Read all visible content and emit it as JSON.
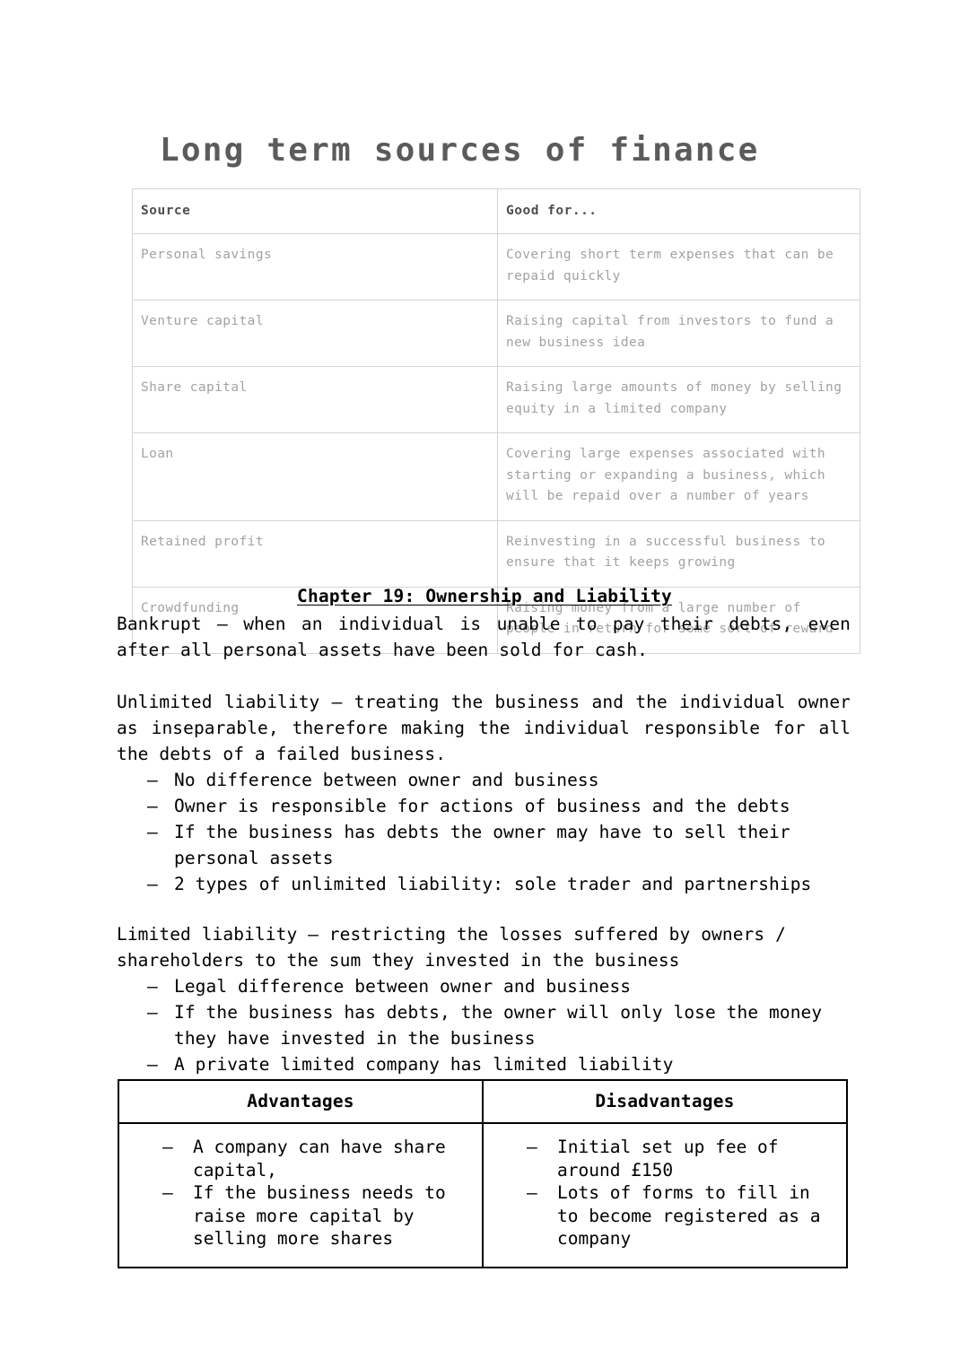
{
  "document": {
    "title": "Long term sources of finance"
  },
  "sources_table": {
    "headers": [
      "Source",
      "Good for..."
    ],
    "rows": [
      {
        "source": "Personal savings",
        "good_for": "Covering short term expenses that can be repaid quickly"
      },
      {
        "source": "Venture capital",
        "good_for": "Raising capital from investors to fund a new business idea"
      },
      {
        "source": "Share capital",
        "good_for": "Raising large amounts of money by selling equity in a limited company"
      },
      {
        "source": "Loan",
        "good_for": "Covering large expenses associated with starting or expanding a business, which will be repaid over a number of years"
      },
      {
        "source": "Retained profit",
        "good_for": "Reinvesting in a successful business to ensure that it keeps growing"
      },
      {
        "source": "Crowdfunding",
        "good_for": "Raising money from a large number of people in return for some sort of reward"
      }
    ]
  },
  "chapter": {
    "heading": "Chapter 19: Ownership and Liability"
  },
  "bankrupt": {
    "definition": "Bankrupt – when an individual is unable to pay their debts, even after all personal assets have been sold for cash."
  },
  "unlimited_liability": {
    "definition": "Unlimited liability – treating the business and the individual owner as inseparable, therefore making the individual responsible for all the debts of a failed business.",
    "bullets": [
      "No difference between owner and business",
      "Owner is responsible for actions of business and the debts",
      "If the business has debts the owner may have to sell their personal assets",
      "2 types of unlimited liability: sole trader and partnerships"
    ],
    "bullet_marker": "–"
  },
  "limited_liability": {
    "definition": "Limited liability – restricting the losses suffered by owners / shareholders to the sum they invested in the business",
    "bullets": [
      "Legal difference between owner and business",
      "If the business has debts, the owner will only lose the money they have invested in the business",
      "A private limited company has limited liability"
    ],
    "bullet_marker": "–"
  },
  "adv_table": {
    "headers": [
      "Advantages",
      "Disadvantages"
    ],
    "bullet_marker": "–",
    "advantages": [
      "A company can have share capital,",
      "If the business needs to raise more capital by selling more shares"
    ],
    "disadvantages": [
      "Initial set up fee of around £150",
      "Lots of forms to fill in to become registered as a company"
    ]
  },
  "colors": {
    "title": "#5b5b5b",
    "table_header_text": "#4e4e4e",
    "table_body_text": "#a2a2a2",
    "table_border": "#d4d4d4",
    "body_text": "#000000",
    "adv_border": "#000000"
  }
}
